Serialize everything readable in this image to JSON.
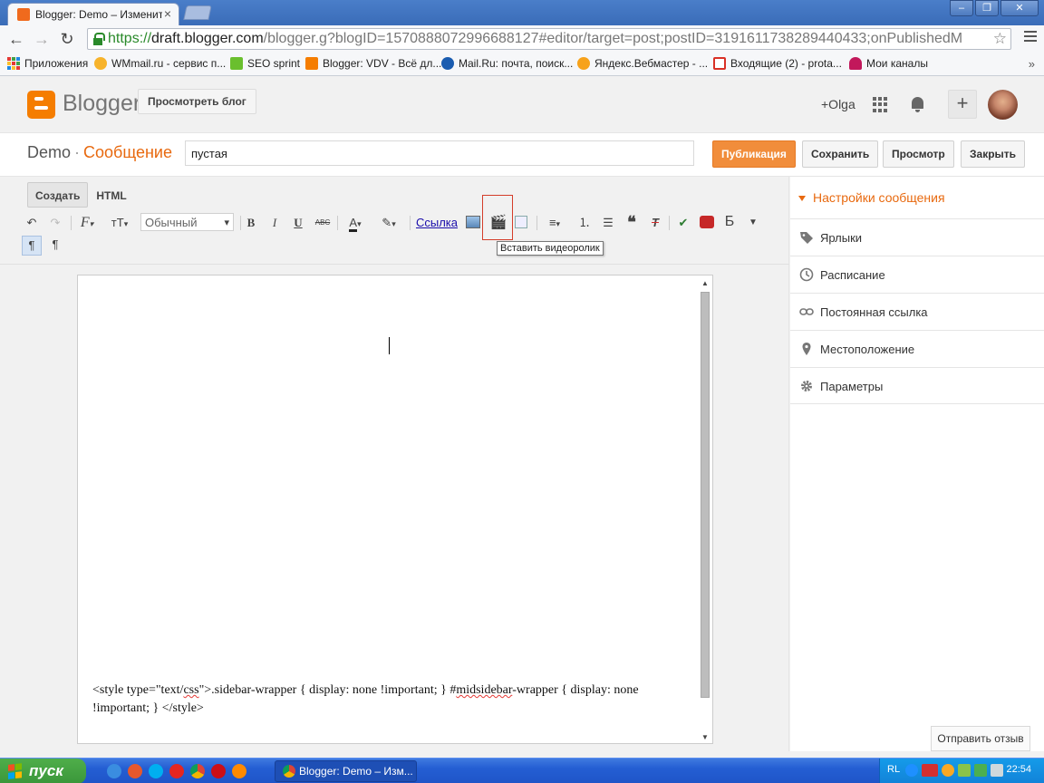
{
  "browser": {
    "tab_title": "Blogger: Demo – Изменить сообщение",
    "url_scheme": "https://",
    "url_host": "draft.blogger.com",
    "url_rest": "/blogger.g?blogID=1570888072996688127#editor/target=post;postID=3191611738289440433;onPublishedM",
    "bookmarks": [
      {
        "label": "Приложения",
        "icon": "apps-icon"
      },
      {
        "label": "WMmail.ru - сервис п...",
        "icon": "wmmail-icon"
      },
      {
        "label": "SEO sprint",
        "icon": "seosprint-icon"
      },
      {
        "label": "Blogger: VDV - Всё дл...",
        "icon": "blogger-icon"
      },
      {
        "label": "Mail.Ru: почта, поиск...",
        "icon": "mailru-icon"
      },
      {
        "label": "Яндекс.Вебмастер - ...",
        "icon": "yandex-icon"
      },
      {
        "label": "Входящие (2) - prota...",
        "icon": "gmail-icon"
      },
      {
        "label": "Мои каналы",
        "icon": "channels-icon"
      }
    ],
    "more": "»"
  },
  "header": {
    "brand": "Blogger",
    "view_blog": "Просмотреть блог",
    "user": "+Olga",
    "plus": "+"
  },
  "post": {
    "blog_name": "Demo",
    "separator": "·",
    "section": "Сообщение",
    "title_value": "пустая",
    "buttons": {
      "publish": "Публикация",
      "save": "Сохранить",
      "preview": "Просмотр",
      "close": "Закрыть"
    }
  },
  "editor": {
    "mode_compose": "Создать",
    "mode_html": "HTML",
    "format_select": "Обычный",
    "link_label": "Ссылка",
    "bold": "B",
    "italic": "I",
    "underline": "U",
    "strike": "ABC",
    "font_color": "A",
    "font_family": "F",
    "font_size": "тT",
    "cyr_b": "Б",
    "tooltip": "Вставить видеоролик",
    "content_line1_a": "<style type=\"text/",
    "content_line1_b": "css",
    "content_line1_c": "\">.sidebar-wrapper { display: none !important; } #",
    "content_line1_d": "midsidebar",
    "content_line1_e": "-wrapper { display: none",
    "content_line2": "!important; } </style>"
  },
  "settings": {
    "heading": "Настройки сообщения",
    "items": [
      {
        "label": "Ярлыки",
        "icon": "tag-icon"
      },
      {
        "label": "Расписание",
        "icon": "clock-icon"
      },
      {
        "label": "Постоянная ссылка",
        "icon": "link-icon"
      },
      {
        "label": "Местоположение",
        "icon": "location-pin-icon"
      },
      {
        "label": "Параметры",
        "icon": "gear-icon"
      }
    ]
  },
  "feedback": "Отправить отзыв",
  "taskbar": {
    "start": "пуск",
    "active_task": "Blogger: Demo – Изм...",
    "lang": "RL",
    "time": "22:54"
  },
  "colors": {
    "blogger_orange": "#f57d00",
    "accent": "#e8690f",
    "publish_button": "#f18d3b"
  }
}
